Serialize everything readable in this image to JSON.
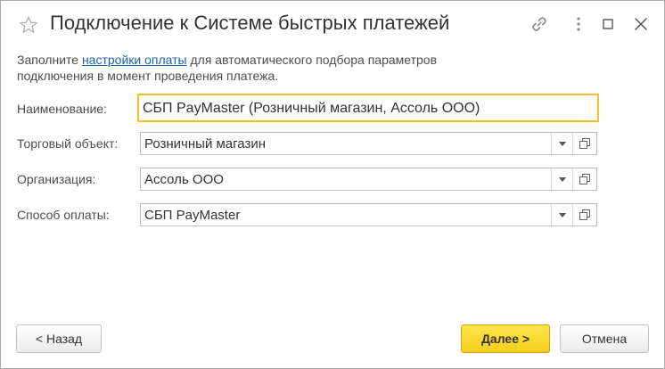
{
  "window": {
    "title": "Подключение к Системе быстрых платежей",
    "icons": [
      "star-icon",
      "link-icon",
      "more-icon",
      "maximize-icon",
      "close-icon"
    ]
  },
  "info": {
    "prefix": "Заполните ",
    "link_text": "настройки оплаты",
    "suffix_line1": " для автоматического подбора параметров",
    "line2": "подключения в момент проведения платежа."
  },
  "form": {
    "name": {
      "label": "Наименование:",
      "value": "СБП PayMaster (Розничный магазин, Ассоль ООО)"
    },
    "store": {
      "label": "Торговый объект:",
      "value": "Розничный магазин"
    },
    "organization": {
      "label": "Организация:",
      "value": "Ассоль ООО"
    },
    "payment_method": {
      "label": "Способ оплаты:",
      "value": "СБП PayMaster"
    }
  },
  "buttons": {
    "back": "< Назад",
    "next": "Далее >",
    "cancel": "Отмена"
  },
  "colors": {
    "accent_focus_border": "#f2c130",
    "primary_button": "#f5cf1c",
    "link": "#1f5fa9"
  }
}
